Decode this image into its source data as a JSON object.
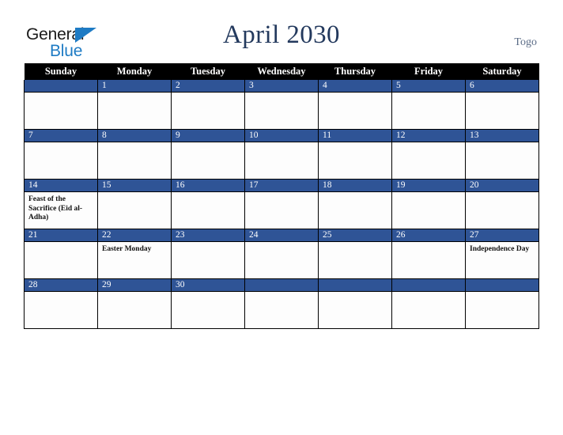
{
  "header": {
    "logo": {
      "text_top": "General",
      "text_bottom": "Blue",
      "triangle_icon": "logo-triangle-icon",
      "color_dark": "#1b1b1b",
      "color_blue": "#1e7bc4"
    },
    "title": "April 2030",
    "country": "Togo"
  },
  "colors": {
    "header_row_bg": "#000000",
    "daynum_bg": "#2f5496",
    "cell_bg": "#fdfdfd",
    "title_color": "#23395d",
    "country_color": "#5a6b86",
    "grid_line": "#000000"
  },
  "calendar": {
    "weekday_headers": [
      "Sunday",
      "Monday",
      "Tuesday",
      "Wednesday",
      "Thursday",
      "Friday",
      "Saturday"
    ],
    "weeks": [
      [
        {
          "day": "",
          "event": ""
        },
        {
          "day": "1",
          "event": ""
        },
        {
          "day": "2",
          "event": ""
        },
        {
          "day": "3",
          "event": ""
        },
        {
          "day": "4",
          "event": ""
        },
        {
          "day": "5",
          "event": ""
        },
        {
          "day": "6",
          "event": ""
        }
      ],
      [
        {
          "day": "7",
          "event": ""
        },
        {
          "day": "8",
          "event": ""
        },
        {
          "day": "9",
          "event": ""
        },
        {
          "day": "10",
          "event": ""
        },
        {
          "day": "11",
          "event": ""
        },
        {
          "day": "12",
          "event": ""
        },
        {
          "day": "13",
          "event": ""
        }
      ],
      [
        {
          "day": "14",
          "event": "Feast of the Sacrifice (Eid al-Adha)"
        },
        {
          "day": "15",
          "event": ""
        },
        {
          "day": "16",
          "event": ""
        },
        {
          "day": "17",
          "event": ""
        },
        {
          "day": "18",
          "event": ""
        },
        {
          "day": "19",
          "event": ""
        },
        {
          "day": "20",
          "event": ""
        }
      ],
      [
        {
          "day": "21",
          "event": ""
        },
        {
          "day": "22",
          "event": "Easter Monday"
        },
        {
          "day": "23",
          "event": ""
        },
        {
          "day": "24",
          "event": ""
        },
        {
          "day": "25",
          "event": ""
        },
        {
          "day": "26",
          "event": ""
        },
        {
          "day": "27",
          "event": "Independence Day"
        }
      ],
      [
        {
          "day": "28",
          "event": ""
        },
        {
          "day": "29",
          "event": ""
        },
        {
          "day": "30",
          "event": ""
        },
        {
          "day": "",
          "event": ""
        },
        {
          "day": "",
          "event": ""
        },
        {
          "day": "",
          "event": ""
        },
        {
          "day": "",
          "event": ""
        }
      ]
    ]
  }
}
